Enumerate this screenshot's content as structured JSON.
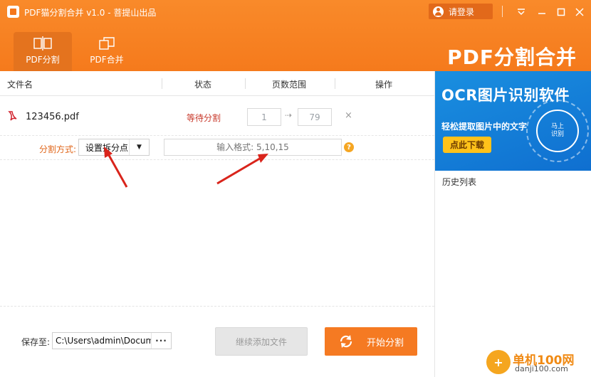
{
  "app": {
    "title": "PDF猫分割合并 v1.0 - 菩提山出品",
    "login_label": "请登录",
    "brand_text": "PDF分割合并",
    "accent_color": "#f57a1c"
  },
  "tabs": [
    {
      "label": "PDF分割",
      "icon": "split-icon",
      "active": true
    },
    {
      "label": "PDF合并",
      "icon": "merge-icon",
      "active": false
    }
  ],
  "table": {
    "headers": [
      "文件名",
      "状态",
      "页数范围",
      "操作"
    ],
    "rows": [
      {
        "file_name": "123456.pdf",
        "status": "等待分割",
        "page_from": "1",
        "page_to": "79",
        "delete_symbol": "×"
      }
    ]
  },
  "split": {
    "label": "分割方式:",
    "selected_method": "设置拆分点",
    "format_placeholder": "输入格式: 5,10,15",
    "help_symbol": "?"
  },
  "footer": {
    "save_label": "保存至:",
    "save_path": "C:\\Users\\admin\\Documents",
    "browse_label": "···",
    "add_button": "继续添加文件",
    "start_button": "开始分割"
  },
  "ad": {
    "title": "OCR图片识别软件",
    "subtitle": "轻松提取图片中的文字",
    "button": "点此下载",
    "circle_line1": "马上",
    "circle_line2": "识别"
  },
  "history": {
    "title": "历史列表"
  },
  "watermark": {
    "line1": "单机100网",
    "line2": "danji100.com"
  }
}
